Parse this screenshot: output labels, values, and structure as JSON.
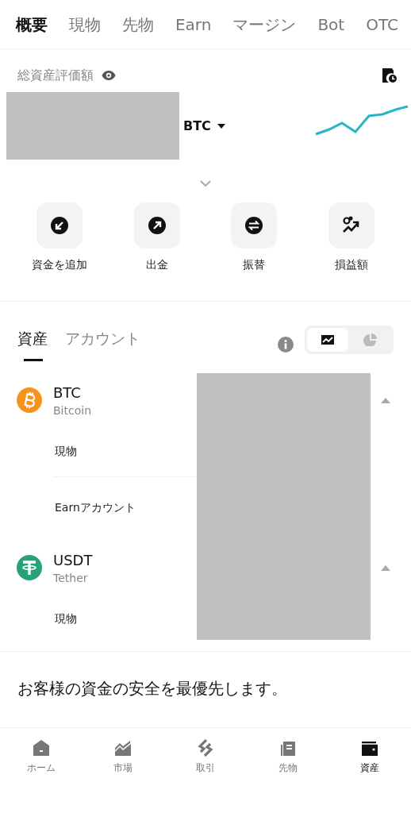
{
  "top_tabs": [
    {
      "label": "概要",
      "selected": true
    },
    {
      "label": "現物",
      "selected": false
    },
    {
      "label": "先物",
      "selected": false
    },
    {
      "label": "Earn",
      "selected": false
    },
    {
      "label": "マージン",
      "selected": false
    },
    {
      "label": "Bot",
      "selected": false
    },
    {
      "label": "OTC",
      "selected": false
    }
  ],
  "total_assets": {
    "label": "総資産評価額",
    "currency": "BTC"
  },
  "actions": [
    {
      "label": "資金を追加",
      "kind": "deposit"
    },
    {
      "label": "出金",
      "kind": "withdraw"
    },
    {
      "label": "振替",
      "kind": "transfer"
    },
    {
      "label": "損益額",
      "kind": "pnl"
    }
  ],
  "asset_tabs": [
    {
      "label": "資産",
      "selected": true
    },
    {
      "label": "アカウント",
      "selected": false
    }
  ],
  "view_toggle": [
    {
      "kind": "chart",
      "selected": true
    },
    {
      "kind": "pie",
      "selected": false
    }
  ],
  "assets": [
    {
      "symbol": "BTC",
      "name": "Bitcoin",
      "kind": "bitcoin",
      "color": "#f7931a",
      "expanded": true,
      "accounts": [
        "現物",
        "Earnアカウント"
      ]
    },
    {
      "symbol": "USDT",
      "name": "Tether",
      "kind": "tether",
      "color": "#26a17b",
      "expanded": true,
      "accounts": [
        "現物"
      ]
    }
  ],
  "banner": "お客様の資金の安全を最優先します。",
  "bottom_nav": [
    {
      "label": "ホーム",
      "kind": "home",
      "selected": false
    },
    {
      "label": "市場",
      "kind": "market",
      "selected": false
    },
    {
      "label": "取引",
      "kind": "trade",
      "selected": false
    },
    {
      "label": "先物",
      "kind": "futures",
      "selected": false
    },
    {
      "label": "資産",
      "kind": "wallet",
      "selected": true
    }
  ]
}
